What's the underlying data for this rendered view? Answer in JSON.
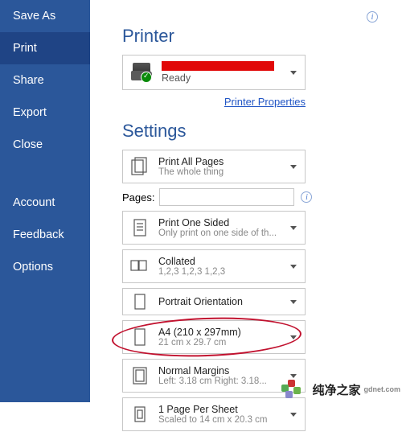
{
  "sidebar": {
    "items": [
      "Save As",
      "Print",
      "Share",
      "Export",
      "Close",
      "Account",
      "Feedback",
      "Options"
    ],
    "activeIndex": 1
  },
  "printer": {
    "heading": "Printer",
    "status": "Ready",
    "link": "Printer Properties"
  },
  "settings": {
    "heading": "Settings",
    "pages_label": "Pages:",
    "pages_value": "",
    "items": [
      {
        "title": "Print All Pages",
        "sub": "The whole thing"
      },
      {
        "title": "Print One Sided",
        "sub": "Only print on one side of th..."
      },
      {
        "title": "Collated",
        "sub": "1,2,3    1,2,3    1,2,3"
      },
      {
        "title": "Portrait Orientation",
        "sub": ""
      },
      {
        "title": "A4 (210 x 297mm)",
        "sub": "21 cm x 29.7 cm"
      },
      {
        "title": "Normal Margins",
        "sub": "Left:  3.18 cm   Right:  3.18..."
      },
      {
        "title": "1 Page Per Sheet",
        "sub": "Scaled to 14 cm x 20.3 cm"
      }
    ]
  },
  "watermark": {
    "text": "纯净之家",
    "sub": "gdnet.com"
  }
}
